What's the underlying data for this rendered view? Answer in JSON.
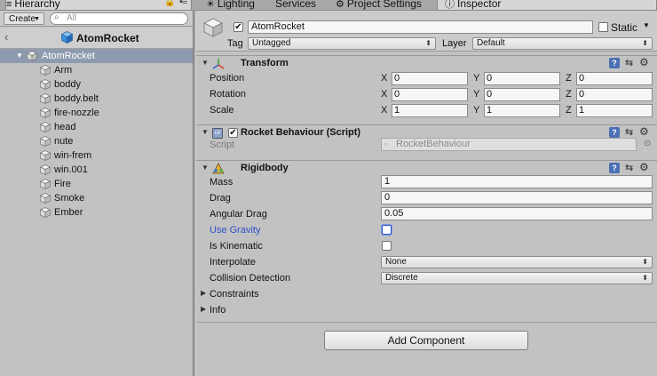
{
  "tabs": {
    "hierarchy": "Hierarchy",
    "lighting": "Lighting",
    "services": "Services",
    "project_settings": "Project Settings",
    "inspector": "Inspector"
  },
  "hierarchy": {
    "create_label": "Create",
    "search_placeholder": "All",
    "scene_title": "AtomRocket",
    "root_item": "AtomRocket",
    "children": [
      "Arm",
      "boddy",
      "boddy.belt",
      "fire-nozzle",
      "head",
      "nute",
      "win-frem",
      "win.001",
      "Fire",
      "Smoke",
      "Ember"
    ]
  },
  "inspector": {
    "object_name": "AtomRocket",
    "static_label": "Static",
    "tag_label": "Tag",
    "tag_value": "Untagged",
    "layer_label": "Layer",
    "layer_value": "Default",
    "transform": {
      "title": "Transform",
      "position_label": "Position",
      "rotation_label": "Rotation",
      "scale_label": "Scale",
      "axis_x": "X",
      "axis_y": "Y",
      "axis_z": "Z",
      "position": [
        "0",
        "0",
        "0"
      ],
      "rotation": [
        "0",
        "0",
        "0"
      ],
      "scale": [
        "1",
        "1",
        "1"
      ]
    },
    "rocket": {
      "title": "Rocket Behaviour (Script)",
      "script_label": "Script",
      "script_value": "RocketBehaviour",
      "badge": "c#"
    },
    "rigidbody": {
      "title": "Rigidbody",
      "mass_label": "Mass",
      "mass": "1",
      "drag_label": "Drag",
      "drag": "0",
      "angular_drag_label": "Angular Drag",
      "angular_drag": "0.05",
      "use_gravity_label": "Use Gravity",
      "is_kinematic_label": "Is Kinematic",
      "interpolate_label": "Interpolate",
      "interpolate_value": "None",
      "collision_label": "Collision Detection",
      "collision_value": "Discrete",
      "constraints_label": "Constraints",
      "info_label": "Info"
    },
    "add_component": "Add Component"
  },
  "icons": {
    "help": "?",
    "preset": "⇆",
    "gear": "⚙"
  },
  "colors": {
    "selection": "#8e9ab0",
    "use_gravity_text": "#2e50c8",
    "help_icon": "#4a6fb5"
  }
}
